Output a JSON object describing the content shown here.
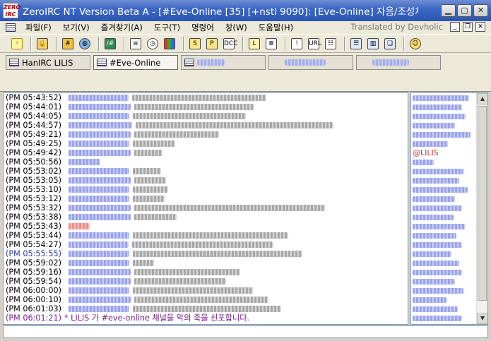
{
  "window": {
    "logo_text": "ZERO IRC",
    "title": "ZeroIRC NT Version Beta A - [#Eve-Online [35] [+nstl 9090]: [Eve-Online] 자음/조성체/색글/도배",
    "translated_by": "Translated by Devholic"
  },
  "menu": {
    "items": [
      "파일(F)",
      "보기(V)",
      "즐겨찾기(A)",
      "도구(T)",
      "명령어",
      "창(W)",
      "도움말(H)"
    ]
  },
  "tabs": [
    {
      "label": "HanIRC LILIS",
      "blurred": false
    },
    {
      "label": "#Eve-Online",
      "blurred": false,
      "active": true
    },
    {
      "label": "",
      "blurred": true
    },
    {
      "label": "",
      "blurred": true
    },
    {
      "label": "",
      "blurred": true
    }
  ],
  "chat": {
    "lines": [
      {
        "time": "(PM 05:43:52)",
        "color": "normal"
      },
      {
        "time": "(PM 05:44:01)",
        "color": "normal"
      },
      {
        "time": "(PM 05:44:05)",
        "color": "normal"
      },
      {
        "time": "(PM 05:44:57)",
        "color": "normal"
      },
      {
        "time": "(PM 05:49:21)",
        "color": "normal"
      },
      {
        "time": "(PM 05:49:25)",
        "color": "normal"
      },
      {
        "time": "(PM 05:49:42)",
        "color": "normal"
      },
      {
        "time": "(PM 05:50:56)",
        "color": "normal"
      },
      {
        "time": "(PM 05:53:02)",
        "color": "normal"
      },
      {
        "time": "(PM 05:53:05)",
        "color": "normal"
      },
      {
        "time": "(PM 05:53:10)",
        "color": "normal"
      },
      {
        "time": "(PM 05:53:12)",
        "color": "normal"
      },
      {
        "time": "(PM 05:53:32)",
        "color": "normal"
      },
      {
        "time": "(PM 05:53:38)",
        "color": "normal"
      },
      {
        "time": "(PM 05:53:43)",
        "color": "normal"
      },
      {
        "time": "(PM 05:53:44)",
        "color": "normal"
      },
      {
        "time": "(PM 05:54:27)",
        "color": "normal"
      },
      {
        "time": "(PM 05:55:55)",
        "color": "blue"
      },
      {
        "time": "(PM 05:59:02)",
        "color": "normal"
      },
      {
        "time": "(PM 05:59:16)",
        "color": "normal"
      },
      {
        "time": "(PM 05:59:54)",
        "color": "normal"
      },
      {
        "time": "(PM 06:00:00)",
        "color": "normal"
      },
      {
        "time": "(PM 06:00:10)",
        "color": "normal"
      },
      {
        "time": "(PM 06:01:03)",
        "color": "normal"
      }
    ],
    "system_line": {
      "time": "(PM 06:01:21)",
      "text": "* LILIS 가 #eve-online 채널을 악의 축을 선포합니다."
    }
  },
  "nicklist": {
    "op_nick": "@LILIS"
  },
  "colors": {
    "titlebar": "#2a55b4",
    "timestamp_blue": "#223aa8",
    "system_purple": "#7a1f8f",
    "op_red": "#c0392b"
  }
}
